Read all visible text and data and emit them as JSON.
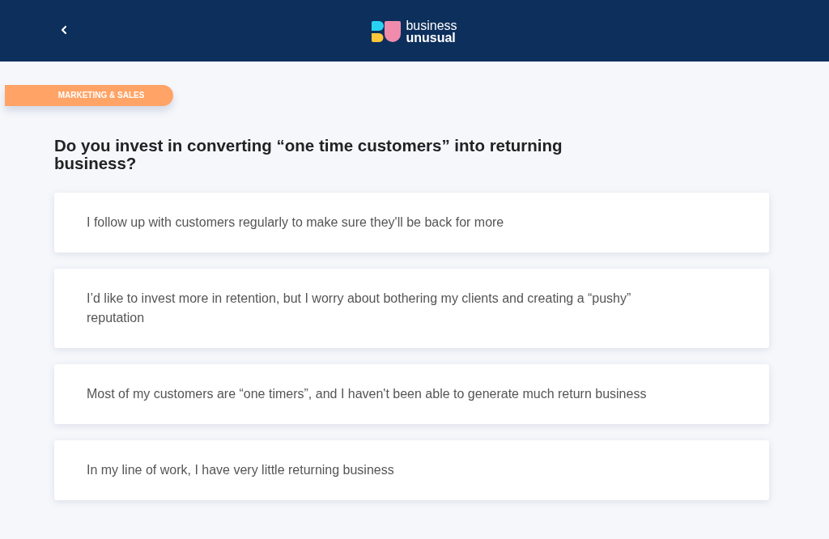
{
  "header": {
    "logo": {
      "line_1": "business",
      "line_2": "unusual"
    }
  },
  "category_tag": "MARKETING & SALES",
  "question": "Do you invest in converting “one time customers” into returning business?",
  "options": [
    {
      "label": "I follow up with customers regularly to make sure they'll be back for more",
      "selected": false
    },
    {
      "label": "I’d like to invest more in retention, but I worry about bothering my clients and creating a “pushy” reputation",
      "selected": false
    },
    {
      "label": "Most of my customers are “one timers”, and I haven't been able to generate much return business",
      "selected": false
    },
    {
      "label": "In my line of work, I have very little returning business",
      "selected": false
    }
  ]
}
